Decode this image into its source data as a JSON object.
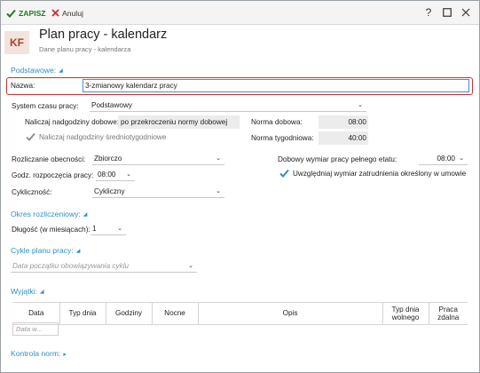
{
  "toolbar": {
    "save_label": "ZAPISZ",
    "cancel_label": "Anuluj",
    "help_label": "?"
  },
  "header": {
    "avatar_initials": "KF",
    "title": "Plan pracy - kalendarz",
    "subtitle": "Dane planu pracy - kalendarza"
  },
  "sections": {
    "basic": "Podstawowe:",
    "settlement": "Okres rozliczeniowy:",
    "cycles": "Cykle planu pracy:",
    "exceptions": "Wyjątki:",
    "norm_control": "Kontrola norm:"
  },
  "form": {
    "name_label": "Nazwa:",
    "name_value": "3-zmianowy kalendarz pracy",
    "time_system_label": "System czasu pracy:",
    "time_system_value": "Podstawowy",
    "overtime_daily_label": "Naliczaj nadgodziny dobowe:",
    "overtime_daily_value": "po przekroczeniu normy dobowej",
    "overtime_avgweekly_label": "Naliczaj nadgodziny średniotygodniowe",
    "daily_norm_label": "Norma dobowa:",
    "daily_norm_value": "08:00",
    "weekly_norm_label": "Norma tygodniowa:",
    "weekly_norm_value": "40:00",
    "attendance_label": "Rozliczanie obecności:",
    "attendance_value": "Zbiorczo",
    "start_hour_label": "Godz. rozpoczęcia pracy:",
    "start_hour_value": "08:00",
    "cyclicity_label": "Cykliczność:",
    "cyclicity_value": "Cykliczny",
    "fulltime_label": "Dobowy wymiar pracy pełnego etatu:",
    "fulltime_value": "08:00",
    "employment_label": "Uwzględniaj wymiar zatrudnienia określony w umowie",
    "length_label": "Długość (w miesiącach):",
    "length_value": "1",
    "cycle_start_placeholder": "Data początku obowiązywania cyklu"
  },
  "exceptions_table": {
    "columns": [
      "Data",
      "Typ dnia",
      "Godziny",
      "Nocne",
      "Opis",
      "Typ dnia wolnego",
      "Praca zdalna"
    ],
    "new_row_placeholder": "Data w..."
  },
  "colors": {
    "accent": "#2f8fc4",
    "save_green": "#1c7c1c",
    "cancel_red": "#d12b2b",
    "highlight_border": "#d12b2b",
    "avatar_bg": "#f3e3dd",
    "avatar_text": "#a2452e"
  }
}
